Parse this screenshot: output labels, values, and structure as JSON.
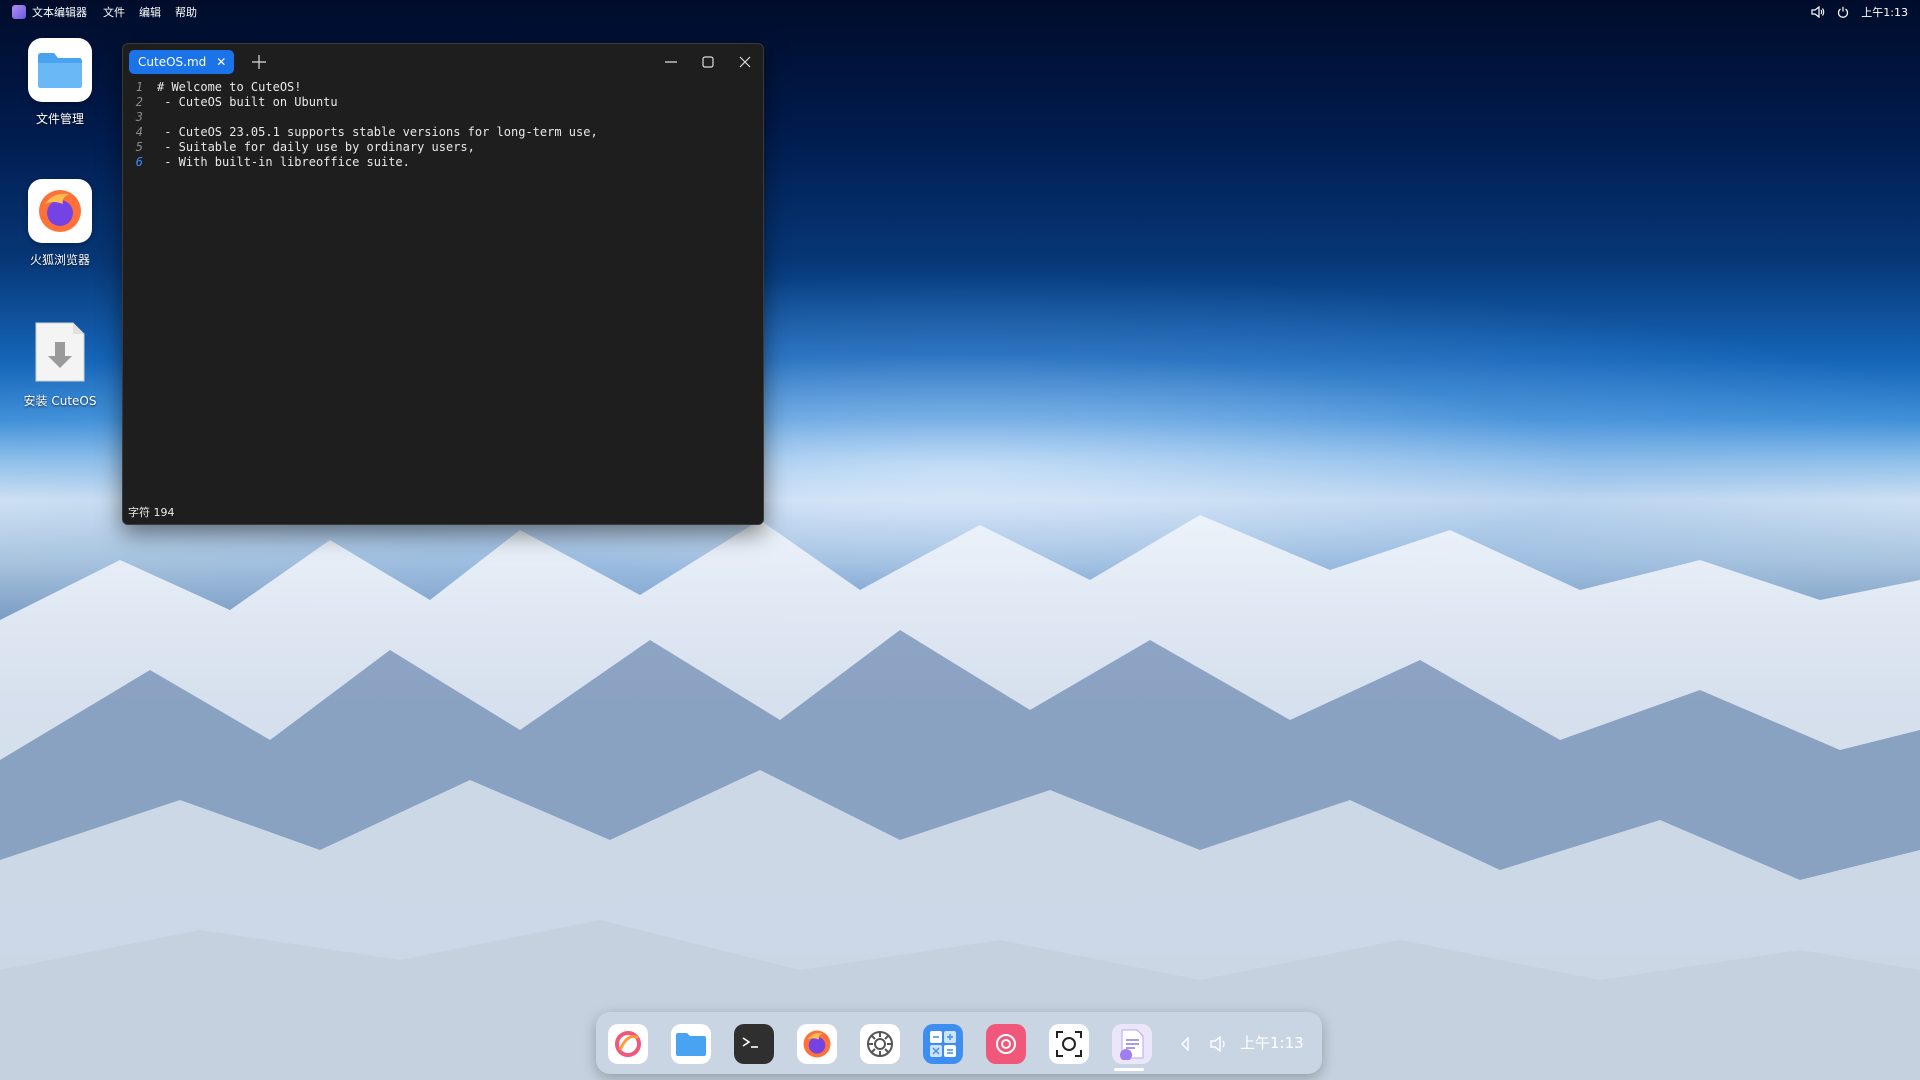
{
  "topbar": {
    "app_name": "文本编辑器",
    "menus": [
      "文件",
      "编辑",
      "帮助"
    ],
    "clock": "上午1:13",
    "icons": [
      "volume-icon",
      "power-icon"
    ]
  },
  "desktop": {
    "icons": [
      {
        "label": "文件管理",
        "icon": "folder-icon"
      },
      {
        "label": "火狐浏览器",
        "icon": "firefox-icon"
      },
      {
        "label": "安装 CuteOS",
        "icon": "install-icon"
      }
    ]
  },
  "editor": {
    "tab_title": "CuteOS.md",
    "lines": [
      {
        "num": "1",
        "text": "# Welcome to CuteOS!"
      },
      {
        "num": "2",
        "text": " - CuteOS built on Ubuntu"
      },
      {
        "num": "3",
        "text": ""
      },
      {
        "num": "4",
        "text": " - CuteOS 23.05.1 supports stable versions for long-term use,"
      },
      {
        "num": "5",
        "text": " - Suitable for daily use by ordinary users,"
      },
      {
        "num": "6",
        "text": " - With built-in libreoffice suite."
      }
    ],
    "active_line": 6,
    "status": "字符 194"
  },
  "dock": {
    "apps": [
      "launcher-icon",
      "files-icon",
      "terminal-icon",
      "firefox-icon",
      "settings-icon",
      "calculator-icon",
      "screen-recorder-icon",
      "screenshot-icon",
      "text-editor-icon"
    ],
    "clock": "上午1:13"
  },
  "colors": {
    "accent": "#1a73e8",
    "editor_bg": "#1e1e1e"
  }
}
